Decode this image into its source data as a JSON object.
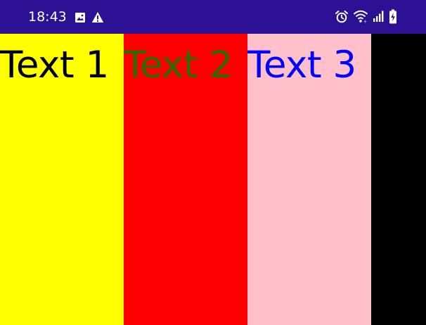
{
  "status_bar": {
    "time": "18:43",
    "background": "#2b1194",
    "left_icons": [
      "image-icon",
      "warning-icon"
    ],
    "right_icons": [
      "alarm-icon",
      "wifi-icon",
      "signal-icon",
      "battery-charging-icon"
    ]
  },
  "columns": [
    {
      "text": "Text 1",
      "background": "#ffff00",
      "text_color": "#000000"
    },
    {
      "text": "Text 2",
      "background": "#ff0000",
      "text_color": "#2e6b00"
    },
    {
      "text": "Text 3",
      "background": "#ffc0cb",
      "text_color": "#0000ff"
    },
    {
      "text": "",
      "background": "#000000",
      "text_color": "#000000"
    }
  ]
}
